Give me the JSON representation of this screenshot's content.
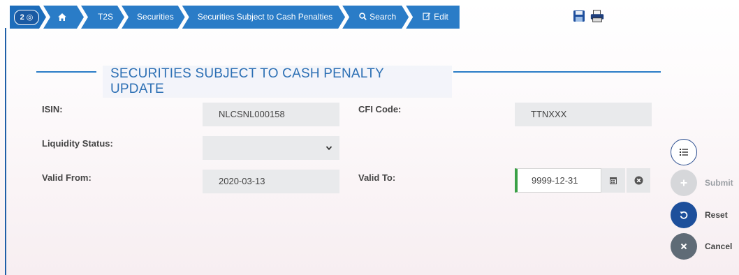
{
  "breadcrumb": {
    "badge": "2 ◎",
    "items": [
      "T2S",
      "Securities",
      "Securities Subject to Cash Penalties"
    ],
    "search_label": "Search",
    "edit_label": "Edit"
  },
  "page": {
    "title": "SECURITIES SUBJECT TO CASH PENALTY UPDATE"
  },
  "form": {
    "isin": {
      "label": "ISIN:",
      "value": "NLCSNL000158"
    },
    "cfi": {
      "label": "CFI Code:",
      "value": "TTNXXX"
    },
    "liquidity": {
      "label": "Liquidity Status:",
      "value": ""
    },
    "valid_from": {
      "label": "Valid From:",
      "value": "2020-03-13"
    },
    "valid_to": {
      "label": "Valid To:",
      "value": "9999-12-31"
    }
  },
  "actions": {
    "submit": "Submit",
    "reset": "Reset",
    "cancel": "Cancel"
  },
  "colors": {
    "breadcrumb": "#2a7cc7",
    "title": "#2c6fb4",
    "reset": "#1d4f9b",
    "cancel": "#5f6b76",
    "valid_indicator": "#3aa046"
  },
  "icons": [
    "eye-icon",
    "home-icon",
    "search-icon",
    "edit-icon",
    "save-icon",
    "print-icon",
    "list-icon",
    "plus-icon",
    "reset-icon",
    "close-icon",
    "calendar-icon",
    "clear-icon",
    "chevron-down-icon"
  ]
}
